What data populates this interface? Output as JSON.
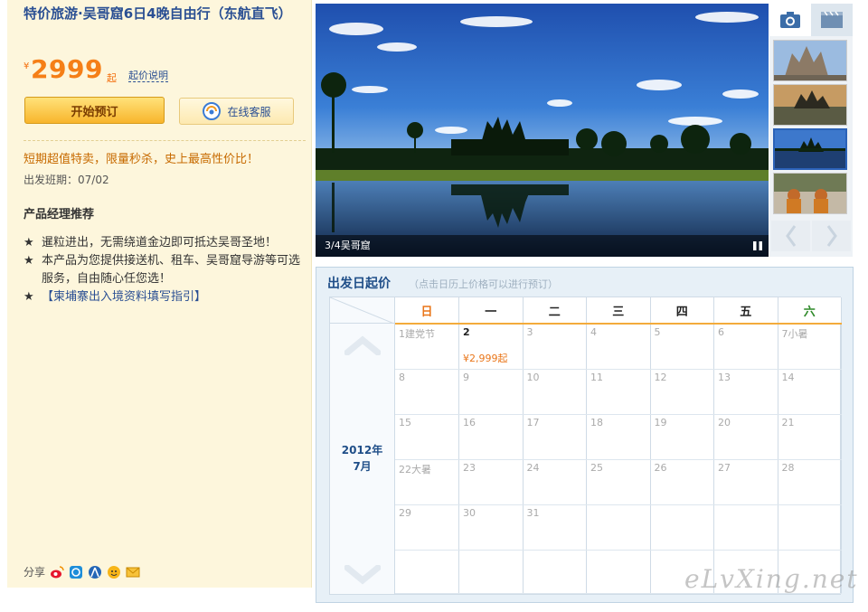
{
  "product": {
    "title": "特价旅游·吴哥窟6日4晚自由行（东航直飞）",
    "currency_symbol": "¥",
    "price": "2999",
    "price_suffix": "起",
    "price_note": "起价说明",
    "book_label": "开始预订",
    "service_label": "在线客服",
    "promo": "短期超值特卖，限量秒杀，史上最高性价比！",
    "departure": "出发班期：07/02",
    "manager_title": "产品经理推荐",
    "recommendations": [
      {
        "star": "★",
        "text": "暹粒进出，无需绕道金边即可抵达吴哥圣地！"
      },
      {
        "star": "★",
        "text": "本产品为您提供接送机、租车、吴哥窟导游等可选服务，自由随心任您选！"
      },
      {
        "star": "★",
        "text": "【柬埔寨出入境资料填写指引】"
      }
    ],
    "share_label": "分享"
  },
  "gallery": {
    "caption": "3/4吴哥窟"
  },
  "calendar": {
    "title": "出发日起价",
    "hint": "（点击日历上价格可以进行预订）",
    "month_year": "2012年",
    "month": "7月",
    "weekdays": [
      "日",
      "一",
      "二",
      "三",
      "四",
      "五",
      "六"
    ],
    "weeks": [
      [
        {
          "d": "1",
          "note": "建党节"
        },
        {
          "d": "2",
          "price": "¥2,999起"
        },
        {
          "d": "3"
        },
        {
          "d": "4"
        },
        {
          "d": "5"
        },
        {
          "d": "6"
        },
        {
          "d": "7",
          "note": "小暑"
        }
      ],
      [
        {
          "d": "8"
        },
        {
          "d": "9"
        },
        {
          "d": "10"
        },
        {
          "d": "11"
        },
        {
          "d": "12"
        },
        {
          "d": "13"
        },
        {
          "d": "14"
        }
      ],
      [
        {
          "d": "15"
        },
        {
          "d": "16"
        },
        {
          "d": "17"
        },
        {
          "d": "18"
        },
        {
          "d": "19"
        },
        {
          "d": "20"
        },
        {
          "d": "21"
        }
      ],
      [
        {
          "d": "22",
          "note": "大暑"
        },
        {
          "d": "23"
        },
        {
          "d": "24"
        },
        {
          "d": "25"
        },
        {
          "d": "26"
        },
        {
          "d": "27"
        },
        {
          "d": "28"
        }
      ],
      [
        {
          "d": "29"
        },
        {
          "d": "30"
        },
        {
          "d": "31"
        },
        {
          "d": ""
        },
        {
          "d": ""
        },
        {
          "d": ""
        },
        {
          "d": ""
        }
      ]
    ]
  },
  "watermark": "eLvXing.net",
  "colors": {
    "price": "#f57f17",
    "title": "#2a4f93",
    "panel_bg": "#fdf6dc",
    "calendar_accent": "#f3ab3b"
  }
}
